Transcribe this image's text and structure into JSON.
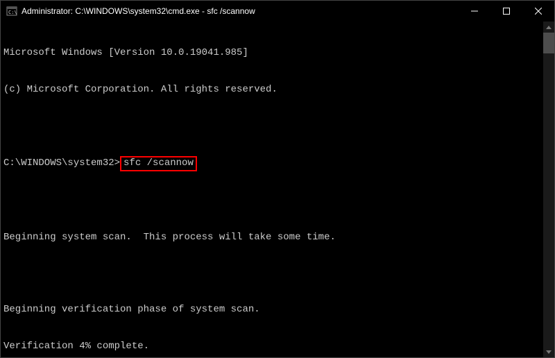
{
  "titlebar": {
    "title": "Administrator: C:\\WINDOWS\\system32\\cmd.exe - sfc  /scannow"
  },
  "terminal": {
    "line1": "Microsoft Windows [Version 10.0.19041.985]",
    "line2": "(c) Microsoft Corporation. All rights reserved.",
    "blank1": "",
    "prompt_prefix": "C:\\WINDOWS\\system32>",
    "prompt_command": "sfc /scannow",
    "blank2": "",
    "line3": "Beginning system scan.  This process will take some time.",
    "blank3": "",
    "line4": "Beginning verification phase of system scan.",
    "line5": "Verification 4% complete."
  }
}
